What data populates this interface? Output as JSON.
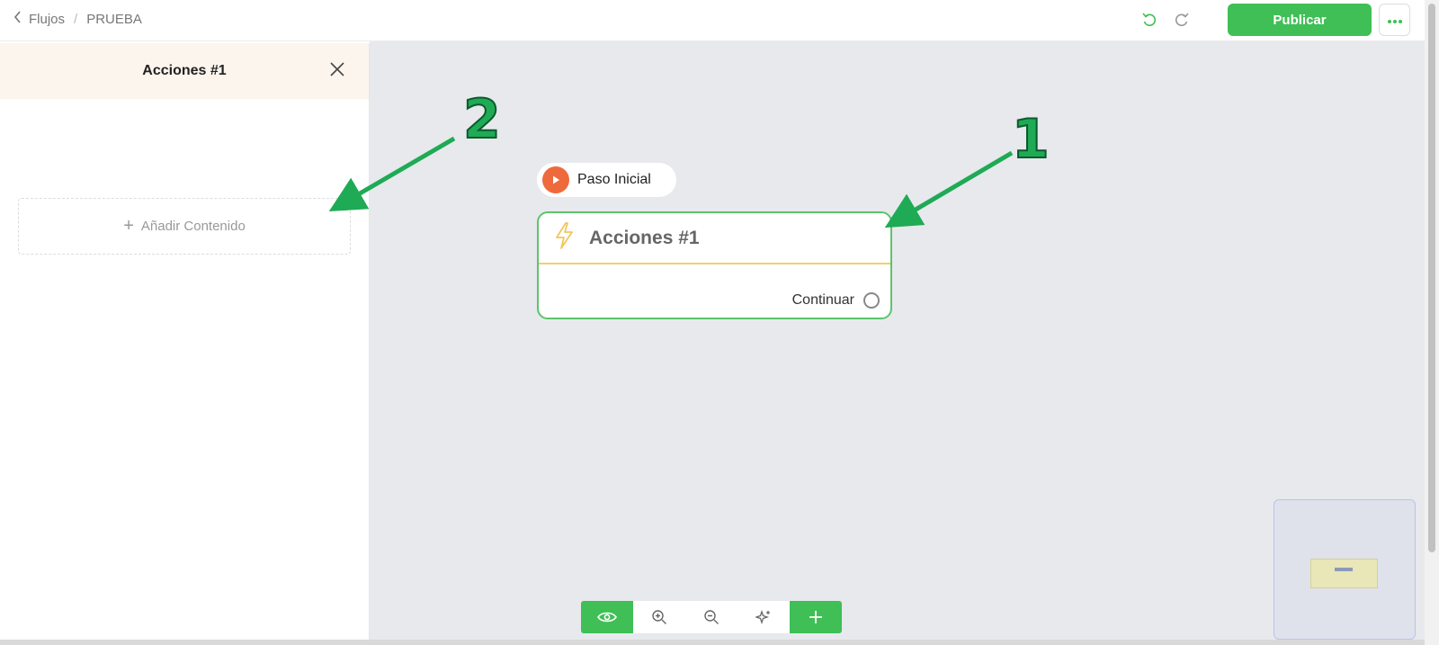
{
  "header": {
    "breadcrumb_parent": "Flujos",
    "breadcrumb_separator": "/",
    "breadcrumb_current": "PRUEBA",
    "publish_label": "Publicar",
    "undo_icon": "undo-icon",
    "redo_icon": "redo-icon",
    "more_icon": "more-dots-icon"
  },
  "panel": {
    "title": "Acciones #1",
    "add_content_label": "Añadir Contenido"
  },
  "canvas": {
    "start_label": "Paso Inicial",
    "node_title": "Acciones #1",
    "node_output_label": "Continuar"
  },
  "callouts": {
    "one": "1",
    "two": "2"
  },
  "toolbar": {
    "items": [
      "preview-eye-icon",
      "zoom-in-icon",
      "zoom-out-icon",
      "magic-sparkle-icon",
      "add-plus-icon"
    ]
  },
  "colors": {
    "accent_green": "#3fbf55",
    "start_orange": "#ee6a3c",
    "node_border": "#5cc46a",
    "node_divider": "#f2cf6a",
    "canvas_bg": "#e7e9ed",
    "panel_header_bg": "#fbf5ee"
  }
}
